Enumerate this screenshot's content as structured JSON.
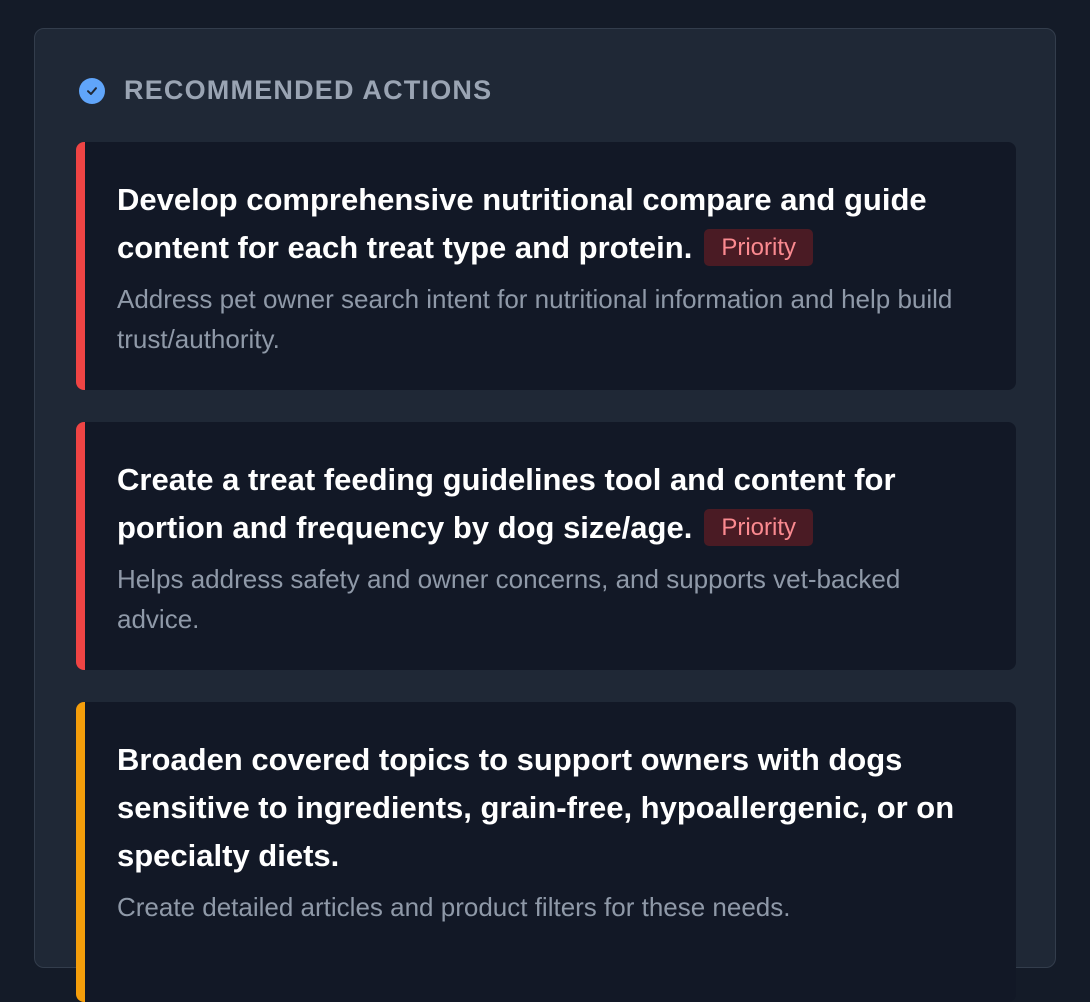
{
  "section": {
    "title": "RECOMMENDED ACTIONS",
    "icon": "check-circle-icon"
  },
  "colors": {
    "high_priority_accent": "#ef4444",
    "medium_priority_accent": "#f59e0b",
    "badge_bg": "#4a1b24",
    "badge_text": "#fb8a90",
    "header_icon": "#60a5fa"
  },
  "actions": [
    {
      "title": "Develop comprehensive nutritional compare and guide content for each treat type and protein.",
      "badge": "Priority",
      "description": "Address pet owner search intent for nutritional information and help build trust/authority."
    },
    {
      "title": "Create a treat feeding guidelines tool and content for portion and frequency by dog size/age.",
      "badge": "Priority",
      "description": "Helps address safety and owner concerns, and supports vet-backed advice."
    },
    {
      "title": "Broaden covered topics to support owners with dogs sensitive to ingredients, grain-free, hypoallergenic, or on specialty diets.",
      "description": "Create detailed articles and product filters for these needs."
    }
  ]
}
